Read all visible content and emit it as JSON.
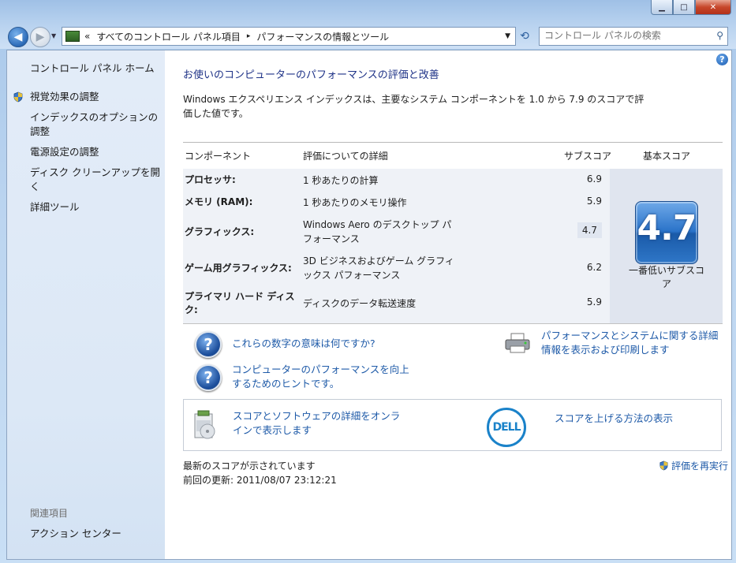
{
  "address": {
    "overflow_chevron": "«",
    "crumbs": [
      "すべてのコントロール パネル項目",
      "パフォーマンスの情報とツール"
    ],
    "separator": "▸"
  },
  "search": {
    "placeholder": "コントロール パネルの検索"
  },
  "sidebar": {
    "home": "コントロール パネル ホーム",
    "links": [
      "視覚効果の調整",
      "インデックスのオプションの調整",
      "電源設定の調整",
      "ディスク クリーンアップを開く",
      "詳細ツール"
    ],
    "related_title": "関連項目",
    "related_links": [
      "アクション センター"
    ]
  },
  "main": {
    "heading": "お使いのコンピューターのパフォーマンスの評価と改善",
    "description": "Windows エクスペリエンス インデックスは、主要なシステム コンポーネントを 1.0 から 7.9 のスコアで評価した値です。"
  },
  "table": {
    "headers": {
      "component": "コンポーネント",
      "details": "評価についての詳細",
      "subscore": "サブスコア",
      "basescore": "基本スコア"
    },
    "rows": [
      {
        "component": "プロセッサ:",
        "details": "1 秒あたりの計算",
        "subscore": "6.9"
      },
      {
        "component": "メモリ (RAM):",
        "details": "1 秒あたりのメモリ操作",
        "subscore": "5.9"
      },
      {
        "component": "グラフィックス:",
        "details": "Windows Aero のデスクトップ パフォーマンス",
        "subscore": "4.7"
      },
      {
        "component": "ゲーム用グラフィックス:",
        "details": "3D ビジネスおよびゲーム グラフィックス パフォーマンス",
        "subscore": "6.2"
      },
      {
        "component": "プライマリ ハード ディスク:",
        "details": "ディスクのデータ転送速度",
        "subscore": "5.9"
      }
    ],
    "base_score": "4.7",
    "base_score_label": "一番低いサブスコア"
  },
  "links": {
    "numbers_meaning": "これらの数字の意味は何ですか?",
    "tips": "コンピューターのパフォーマンスを向上するためのヒントです。",
    "print_details": "パフォーマンスとシステムに関する詳細情報を表示および印刷します",
    "online_details": "スコアとソフトウェアの詳細をオンラインで表示します",
    "improve_score": "スコアを上げる方法の表示",
    "dell_logo_text": "DELL"
  },
  "status": {
    "current": "最新のスコアが示されています",
    "last_update": "前回の更新: 2011/08/07 23:12:21",
    "rerun": "評価を再実行"
  }
}
